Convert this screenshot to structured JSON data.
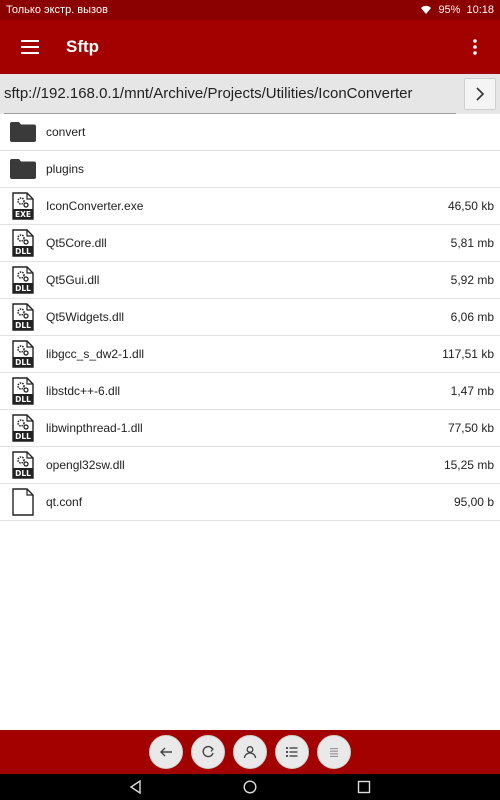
{
  "status_bar": {
    "carrier_text": "Только экстр. вызов",
    "battery": "95%",
    "time": "10:18"
  },
  "app_bar": {
    "title": "Sftp"
  },
  "path": {
    "value": "sftp://192.168.0.1/mnt/Archive/Projects/Utilities/IconConverter"
  },
  "files": [
    {
      "icon": "folder-icon",
      "name": "convert",
      "size": ""
    },
    {
      "icon": "folder-icon",
      "name": "plugins",
      "size": ""
    },
    {
      "icon": "exe-file-icon",
      "name": "IconConverter.exe",
      "size": "46,50 kb"
    },
    {
      "icon": "dll-file-icon",
      "name": "Qt5Core.dll",
      "size": "5,81 mb"
    },
    {
      "icon": "dll-file-icon",
      "name": "Qt5Gui.dll",
      "size": "5,92 mb"
    },
    {
      "icon": "dll-file-icon",
      "name": "Qt5Widgets.dll",
      "size": "6,06 mb"
    },
    {
      "icon": "dll-file-icon",
      "name": "libgcc_s_dw2-1.dll",
      "size": "117,51 kb"
    },
    {
      "icon": "dll-file-icon",
      "name": "libstdc++-6.dll",
      "size": "1,47 mb"
    },
    {
      "icon": "dll-file-icon",
      "name": "libwinpthread-1.dll",
      "size": "77,50 kb"
    },
    {
      "icon": "dll-file-icon",
      "name": "opengl32sw.dll",
      "size": "15,25 mb"
    },
    {
      "icon": "generic-file-icon",
      "name": "qt.conf",
      "size": "95,00 b"
    }
  ],
  "file_labels": {
    "exe": "EXE",
    "dll": "DLL"
  },
  "bottom_toolbar": {
    "buttons": [
      "back-arrow-icon",
      "refresh-icon",
      "user-icon",
      "list-icon",
      "menu-lines-icon"
    ]
  },
  "colors": {
    "status_bar": "#8b0000",
    "app_bar": "#a30000",
    "path_bg": "#e6e6e6",
    "nav_bar": "#000000"
  }
}
